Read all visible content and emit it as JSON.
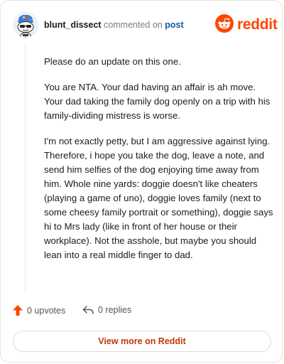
{
  "comment": {
    "username": "blunt_dissect",
    "verb": "commented on",
    "post_link": "post",
    "paragraphs": [
      "Please do an update on this one.",
      "You are NTA. Your dad having an affair is ah move. Your dad taking the family dog openly on a trip with his family-dividing mistress is worse.",
      "I'm not exactly petty, but I am aggressive against lying. Therefore, i hope you take the dog, leave a note, and send him selfies of the dog enjoying time away from him. Whole nine yards: doggie doesn't like cheaters (playing a game of uno), doggie loves family (next to some cheesy family portrait or something), doggie says hi to Mrs lady (like in front of her house or their workplace). Not the asshole, but maybe you should lean into a real middle finger to dad."
    ]
  },
  "brand": {
    "wordmark": "reddit",
    "icon": "reddit-snoo-icon",
    "color": "#ff4500"
  },
  "actions": {
    "upvotes_label": "0 upvotes",
    "replies_label": "0 replies",
    "upvote_icon": "upvote-arrow-icon",
    "reply_icon": "reply-icon",
    "upvote_color": "#ff4500"
  },
  "footer": {
    "view_button_label": "View more on Reddit",
    "accent": "#c0390b"
  }
}
